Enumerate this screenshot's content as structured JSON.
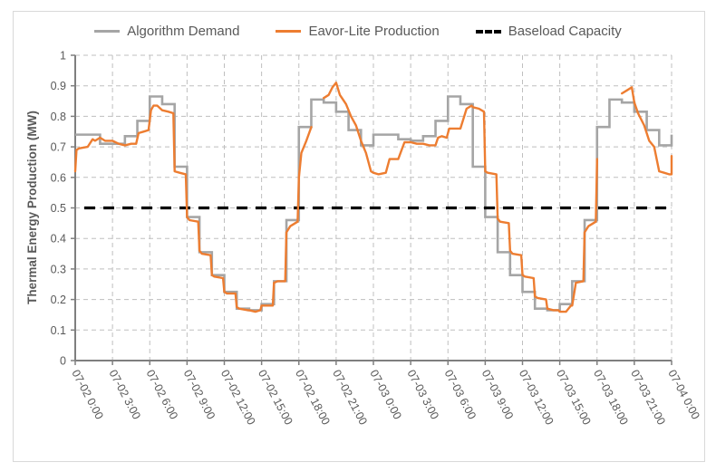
{
  "chart_data": {
    "type": "line",
    "title": "",
    "xlabel": "",
    "ylabel": "Thermal Energy Production (MW)",
    "ylim": [
      0,
      1
    ],
    "xlim_hours": [
      0,
      48
    ],
    "yticks": [
      "0",
      "0.1",
      "0.2",
      "0.3",
      "0.4",
      "0.5",
      "0.6",
      "0.7",
      "0.8",
      "0.9",
      "1"
    ],
    "xticks": [
      "07-02 0:00",
      "07-02 3:00",
      "07-02 6:00",
      "07-02 9:00",
      "07-02 12:00",
      "07-02 15:00",
      "07-02 18:00",
      "07-02 21:00",
      "07-03 0:00",
      "07-03 3:00",
      "07-03 6:00",
      "07-03 9:00",
      "07-03 12:00",
      "07-03 15:00",
      "07-03 18:00",
      "07-03 21:00",
      "07-04 0:00"
    ],
    "grid": true,
    "legend_position": "top",
    "series": [
      {
        "name": "Algorithm Demand",
        "color": "#a5a5a5",
        "style": "step",
        "x_hours": [
          0,
          1,
          2,
          3,
          4,
          5,
          6,
          7,
          8,
          9,
          10,
          11,
          12,
          13,
          14,
          15,
          16,
          17,
          18,
          19,
          20,
          21,
          22,
          23,
          24,
          25,
          26,
          27,
          28,
          29,
          30,
          31,
          32,
          33,
          34,
          35,
          36,
          37,
          38,
          39,
          40,
          41,
          42,
          43,
          44,
          45,
          46,
          47
        ],
        "values": [
          0.74,
          0.74,
          0.71,
          0.71,
          0.735,
          0.785,
          0.865,
          0.84,
          0.635,
          0.47,
          0.355,
          0.28,
          0.225,
          0.17,
          0.165,
          0.185,
          0.26,
          0.46,
          0.765,
          0.855,
          0.845,
          0.815,
          0.755,
          0.705,
          0.74,
          0.74,
          0.725,
          0.72,
          0.735,
          0.785,
          0.865,
          0.84,
          0.635,
          0.47,
          0.355,
          0.28,
          0.225,
          0.17,
          0.165,
          0.185,
          0.26,
          0.46,
          0.765,
          0.855,
          0.845,
          0.815,
          0.755,
          0.705
        ],
        "end_value": 0.74
      },
      {
        "name": "Eavor-Lite Production",
        "color": "#ed7d31",
        "style": "line",
        "segments": [
          {
            "x_hours": [
              0,
              0.1,
              0.3,
              1.0,
              1.4,
              1.6,
              2.0,
              2.4,
              3.0,
              3.5,
              4.0,
              4.5,
              4.9,
              5.1,
              5.5,
              5.9,
              6.1,
              6.3,
              6.6,
              7.0,
              7.5,
              7.9,
              8.0,
              8.4,
              8.9,
              9.0,
              9.2,
              9.9,
              10.0,
              10.2,
              10.9,
              11.0,
              11.2,
              11.9,
              12.0,
              12.2,
              12.9,
              13.0,
              13.2,
              13.9,
              14.0,
              14.5,
              14.9,
              15.0,
              15.5,
              15.9,
              16.0,
              16.3,
              16.9,
              17.0,
              17.3,
              17.9,
              18.0,
              18.2,
              18.6,
              19.0
            ],
            "values": [
              0.62,
              0.69,
              0.695,
              0.7,
              0.725,
              0.72,
              0.73,
              0.72,
              0.72,
              0.71,
              0.705,
              0.71,
              0.71,
              0.745,
              0.75,
              0.755,
              0.82,
              0.835,
              0.835,
              0.82,
              0.815,
              0.81,
              0.62,
              0.615,
              0.61,
              0.47,
              0.46,
              0.455,
              0.36,
              0.35,
              0.345,
              0.28,
              0.275,
              0.27,
              0.225,
              0.22,
              0.22,
              0.175,
              0.17,
              0.165,
              0.165,
              0.16,
              0.165,
              0.18,
              0.18,
              0.18,
              0.255,
              0.26,
              0.26,
              0.42,
              0.44,
              0.455,
              0.6,
              0.68,
              0.72,
              0.765
            ]
          },
          {
            "x_hours": [
              20.0,
              20.4,
              20.7,
              21.0,
              21.3,
              21.8,
              22.2,
              22.6,
              23.0,
              23.4,
              23.8,
              24.0,
              24.4,
              25.0,
              25.3,
              25.6,
              26.0,
              26.5,
              27.0,
              27.5,
              28.0,
              28.5,
              29.0,
              29.2,
              29.5,
              29.9,
              30.1,
              30.5,
              31.0,
              31.5,
              31.9,
              32.0,
              32.5,
              32.9,
              33.0,
              33.2,
              33.9,
              34.0,
              34.2,
              34.9,
              35.0,
              35.2,
              35.9,
              36.0,
              36.2,
              36.9,
              37.0,
              37.2,
              37.9,
              38.0,
              38.5,
              38.9,
              39.0,
              39.5,
              39.9,
              40.0,
              40.3,
              40.9,
              41.0,
              41.3,
              41.9,
              42.0
            ],
            "values": [
              0.86,
              0.87,
              0.895,
              0.91,
              0.87,
              0.84,
              0.8,
              0.77,
              0.72,
              0.68,
              0.62,
              0.615,
              0.61,
              0.615,
              0.66,
              0.66,
              0.66,
              0.715,
              0.715,
              0.71,
              0.71,
              0.705,
              0.705,
              0.73,
              0.735,
              0.73,
              0.76,
              0.76,
              0.76,
              0.825,
              0.835,
              0.83,
              0.825,
              0.815,
              0.62,
              0.615,
              0.61,
              0.465,
              0.455,
              0.45,
              0.36,
              0.35,
              0.345,
              0.28,
              0.275,
              0.27,
              0.21,
              0.205,
              0.2,
              0.17,
              0.165,
              0.165,
              0.16,
              0.16,
              0.18,
              0.18,
              0.255,
              0.26,
              0.42,
              0.44,
              0.455,
              0.66
            ]
          },
          {
            "x_hours": [
              44.0,
              44.4,
              44.8,
              45.0,
              45.3,
              45.8,
              46.2,
              46.6,
              47.0,
              47.4,
              47.8,
              48.0,
              48.0
            ],
            "values": [
              0.875,
              0.885,
              0.895,
              0.845,
              0.81,
              0.77,
              0.72,
              0.7,
              0.62,
              0.615,
              0.61,
              0.61,
              0.67
            ]
          }
        ]
      },
      {
        "name": "Baseload Capacity",
        "color": "#000000",
        "style": "dashed",
        "x_hours": [
          0,
          48
        ],
        "values": [
          0.5,
          0.5
        ]
      }
    ]
  }
}
